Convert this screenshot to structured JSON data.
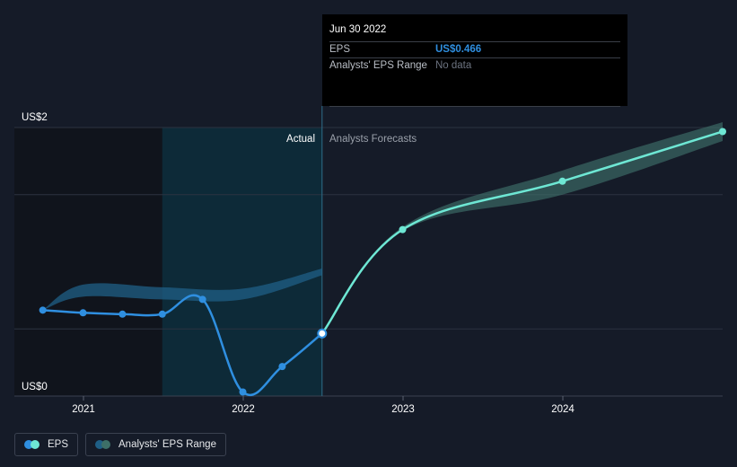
{
  "chart_data": {
    "type": "line",
    "y_tick_labels": [
      "US$2",
      "US$0"
    ],
    "x_tick_labels": [
      "2021",
      "2022",
      "2023",
      "2024"
    ],
    "ylim": [
      0,
      2
    ],
    "divider_date": "2022-06-30",
    "region_labels": {
      "actual": "Actual",
      "forecast": "Analysts Forecasts"
    },
    "series": [
      {
        "name": "EPS",
        "color": "#2f8fe0",
        "points": [
          {
            "x": "2020-09-30",
            "y": 0.64
          },
          {
            "x": "2020-12-31",
            "y": 0.62
          },
          {
            "x": "2021-03-31",
            "y": 0.61
          },
          {
            "x": "2021-06-30",
            "y": 0.61
          },
          {
            "x": "2021-09-30",
            "y": 0.72
          },
          {
            "x": "2021-12-31",
            "y": 0.03
          },
          {
            "x": "2022-03-31",
            "y": 0.22
          },
          {
            "x": "2022-06-30",
            "y": 0.466
          }
        ]
      },
      {
        "name": "EPS Forecast",
        "color": "#6ee7d4",
        "points": [
          {
            "x": "2022-06-30",
            "y": 0.466
          },
          {
            "x": "2022-12-31",
            "y": 1.24
          },
          {
            "x": "2023-12-31",
            "y": 1.6
          },
          {
            "x": "2024-12-31",
            "y": 1.97
          }
        ]
      }
    ],
    "analyst_range": {
      "name": "Analysts' EPS Range",
      "color": "#2a6e90",
      "hist_low": [
        {
          "x": "2020-09-30",
          "y": 0.64
        },
        {
          "x": "2020-12-31",
          "y": 0.74
        },
        {
          "x": "2021-06-30",
          "y": 0.72
        },
        {
          "x": "2021-12-31",
          "y": 0.72
        },
        {
          "x": "2022-06-30",
          "y": 0.9
        }
      ],
      "hist_high": [
        {
          "x": "2020-09-30",
          "y": 0.64
        },
        {
          "x": "2020-12-31",
          "y": 0.83
        },
        {
          "x": "2021-06-30",
          "y": 0.81
        },
        {
          "x": "2021-12-31",
          "y": 0.8
        },
        {
          "x": "2022-06-30",
          "y": 0.95
        }
      ],
      "fc_low": [
        {
          "x": "2022-12-31",
          "y": 1.23
        },
        {
          "x": "2023-12-31",
          "y": 1.5
        },
        {
          "x": "2024-12-31",
          "y": 1.9
        }
      ],
      "fc_high": [
        {
          "x": "2022-12-31",
          "y": 1.26
        },
        {
          "x": "2023-12-31",
          "y": 1.68
        },
        {
          "x": "2024-12-31",
          "y": 2.04
        }
      ]
    }
  },
  "tooltip": {
    "date": "Jun 30 2022",
    "eps_label": "EPS",
    "eps_value": "US$0.466",
    "range_label": "Analysts' EPS Range",
    "range_value": "No data"
  },
  "legend": {
    "eps_label": "EPS",
    "range_label": "Analysts' EPS Range"
  }
}
